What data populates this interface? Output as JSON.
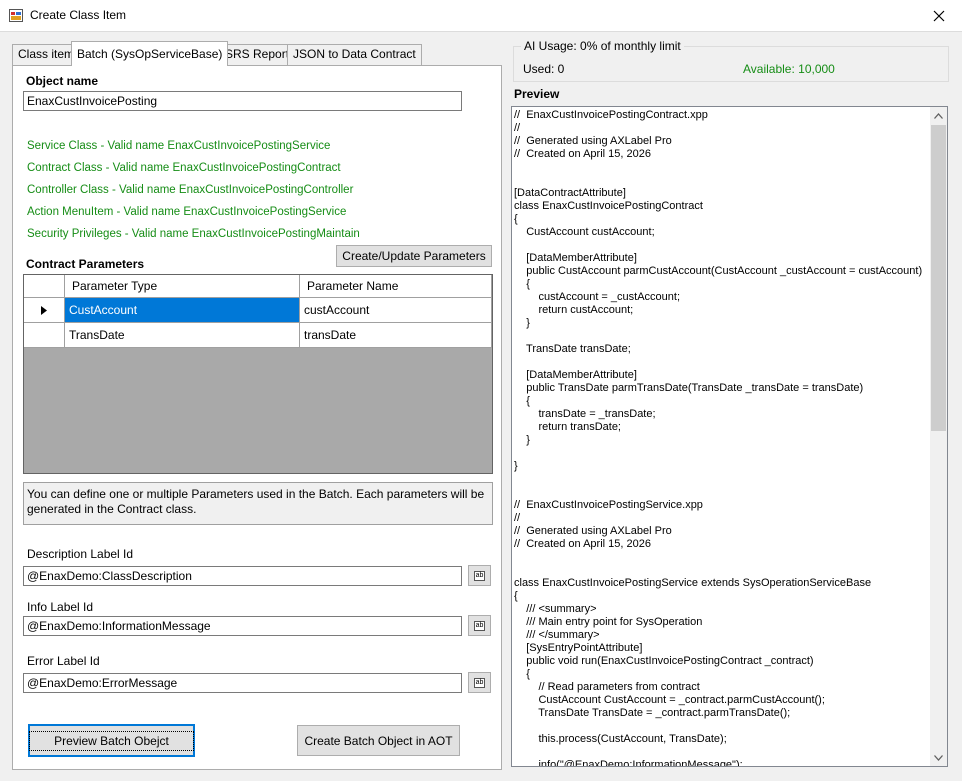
{
  "window": {
    "title": "Create Class Item"
  },
  "tabs": [
    "Class item",
    "Batch (SysOpServiceBase)",
    "SSRS Report",
    "JSON to Data Contract"
  ],
  "form": {
    "object_name_label": "Object name",
    "object_name_value": "EnaxCustInvoicePosting",
    "validations": [
      "Service Class - Valid name EnaxCustInvoicePostingService",
      "Contract Class - Valid name EnaxCustInvoicePostingContract",
      "Controller Class - Valid name EnaxCustInvoicePostingController",
      "Action MenuItem - Valid name EnaxCustInvoicePostingService",
      "Security Privileges - Valid name EnaxCustInvoicePostingMaintain"
    ],
    "create_update_button": "Create/Update Parameters",
    "contract_params_label": "Contract Parameters",
    "grid": {
      "columns": [
        "Parameter Type",
        "Parameter Name"
      ],
      "rows": [
        {
          "type": "CustAccount",
          "name": "custAccount"
        },
        {
          "type": "TransDate",
          "name": "transDate"
        }
      ]
    },
    "info_text": "You can define one or multiple Parameters used in the Batch. Each parameters will be generated in the Contract class.",
    "description_label": "Description Label Id",
    "description_value": "@EnaxDemo:ClassDescription",
    "info_label": "Info Label Id",
    "info_value": "@EnaxDemo:InformationMessage",
    "error_label": "Error Label Id",
    "error_value": "@EnaxDemo:ErrorMessage",
    "browse_glyph": "ab",
    "preview_button": "Preview Batch Obejct",
    "create_button": "Create Batch Object in AOT"
  },
  "usage": {
    "title": "AI Usage: 0% of monthly limit",
    "used": "Used: 0",
    "available": "Available: 10,000",
    "available_color": "#168d16"
  },
  "preview": {
    "label": "Preview",
    "code": "//  EnaxCustInvoicePostingContract.xpp\n//\n//  Generated using AXLabel Pro\n//  Created on April 15, 2026\n\n\n[DataContractAttribute]\nclass EnaxCustInvoicePostingContract\n{\n    CustAccount custAccount;\n\n    [DataMemberAttribute]\n    public CustAccount parmCustAccount(CustAccount _custAccount = custAccount)\n    {\n        custAccount = _custAccount;\n        return custAccount;\n    }\n\n    TransDate transDate;\n\n    [DataMemberAttribute]\n    public TransDate parmTransDate(TransDate _transDate = transDate)\n    {\n        transDate = _transDate;\n        return transDate;\n    }\n\n}\n\n\n//  EnaxCustInvoicePostingService.xpp\n//\n//  Generated using AXLabel Pro\n//  Created on April 15, 2026\n\n\nclass EnaxCustInvoicePostingService extends SysOperationServiceBase\n{\n    /// <summary>\n    /// Main entry point for SysOperation\n    /// </summary>\n    [SysEntryPointAttribute]\n    public void run(EnaxCustInvoicePostingContract _contract)\n    {\n        // Read parameters from contract\n        CustAccount CustAccount = _contract.parmCustAccount();\n        TransDate TransDate = _contract.parmTransDate();\n\n        this.process(CustAccount, TransDate);\n\n        info(\"@EnaxDemo:InformationMessage\");"
  }
}
